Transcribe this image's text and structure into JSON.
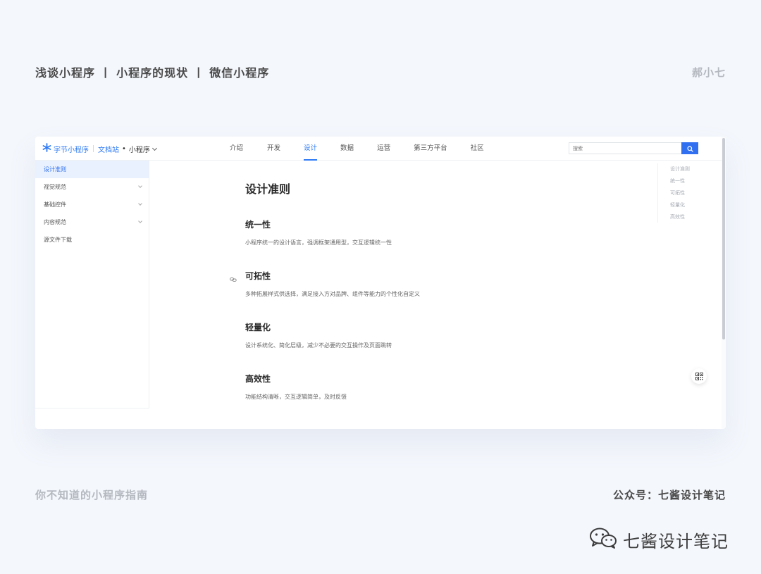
{
  "header": {
    "title": "浅谈小程序 丨 小程序的现状 丨 微信小程序",
    "author": "郝小七"
  },
  "app": {
    "brand_name": "字节小程序",
    "docs_label": "文档站",
    "dot": "•",
    "product_label": "小程序",
    "brand_icon": "asterisk-logo-icon",
    "accent_color": "#2f7bf5"
  },
  "nav": {
    "items": [
      {
        "label": "介绍"
      },
      {
        "label": "开发"
      },
      {
        "label": "设计"
      },
      {
        "label": "数据"
      },
      {
        "label": "运营"
      },
      {
        "label": "第三方平台"
      },
      {
        "label": "社区"
      }
    ],
    "active": "设计"
  },
  "search": {
    "placeholder": "搜索",
    "button_icon": "search-icon"
  },
  "sidebar": {
    "items": [
      {
        "label": "设计准则",
        "active": true,
        "expandable": false
      },
      {
        "label": "视觉规范",
        "active": false,
        "expandable": true
      },
      {
        "label": "基础控件",
        "active": false,
        "expandable": true
      },
      {
        "label": "内容规范",
        "active": false,
        "expandable": true
      },
      {
        "label": "源文件下载",
        "active": false,
        "expandable": false
      }
    ]
  },
  "main": {
    "title": "设计准则",
    "sections": [
      {
        "heading": "统一性",
        "desc": "小程序统一的设计语言，强调框架通用型，交互逻辑统一性"
      },
      {
        "heading": "可拓性",
        "desc": "多种拓展样式供选择，满足接入方对品牌、组件等能力的个性化自定义"
      },
      {
        "heading": "轻量化",
        "desc": "设计系统化、简化层级，减少不必要的交互操作及页面跳转"
      },
      {
        "heading": "高效性",
        "desc": "功能结构清晰，交互逻辑简单，及时反馈"
      }
    ]
  },
  "toc": {
    "items": [
      "设计准则",
      "统一性",
      "可拓性",
      "轻量化",
      "高效性"
    ]
  },
  "footer": {
    "left": "你不知道的小程序指南",
    "right": "公众号：七酱设计笔记"
  },
  "watermark": {
    "text": "七酱设计笔记",
    "icon": "wechat-icon"
  }
}
